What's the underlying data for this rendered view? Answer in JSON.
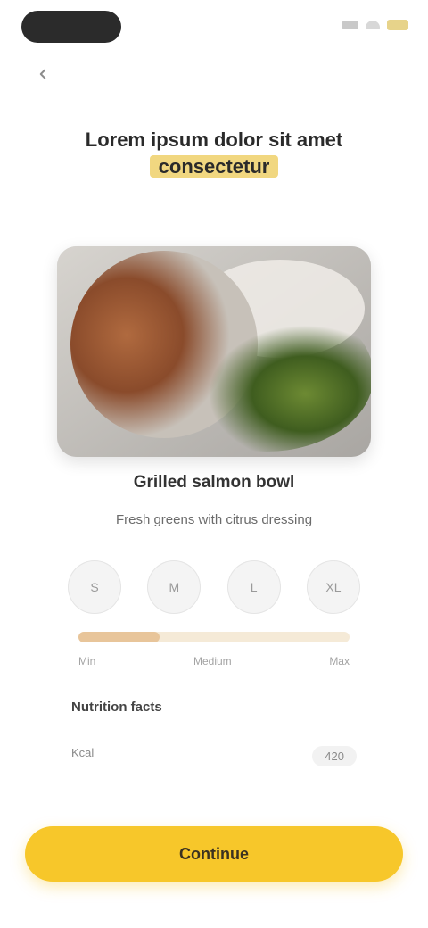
{
  "header": {
    "title_part1": "Lorem ipsum dolor sit amet",
    "title_highlight": "consectetur"
  },
  "dish": {
    "name": "Grilled salmon bowl",
    "description": "Fresh greens with citrus dressing"
  },
  "options": [
    {
      "label": "S"
    },
    {
      "label": "M"
    },
    {
      "label": "L"
    },
    {
      "label": "XL"
    }
  ],
  "progress": {
    "value_percent": 30,
    "left_label": "Min",
    "middle_label": "Medium",
    "right_label": "Max"
  },
  "section": {
    "label": "Nutrition facts"
  },
  "row": {
    "left_text": "Kcal",
    "right_text": "420"
  },
  "cta": {
    "label": "Continue"
  },
  "colors": {
    "accent": "#f7c72a",
    "highlight": "#f1d780",
    "progress_track": "#f5ead7",
    "progress_fill": "#e8c59a"
  },
  "icons": {
    "back": "back-arrow-icon",
    "signal": "signal-icon",
    "wifi": "wifi-icon",
    "battery": "battery-icon"
  }
}
